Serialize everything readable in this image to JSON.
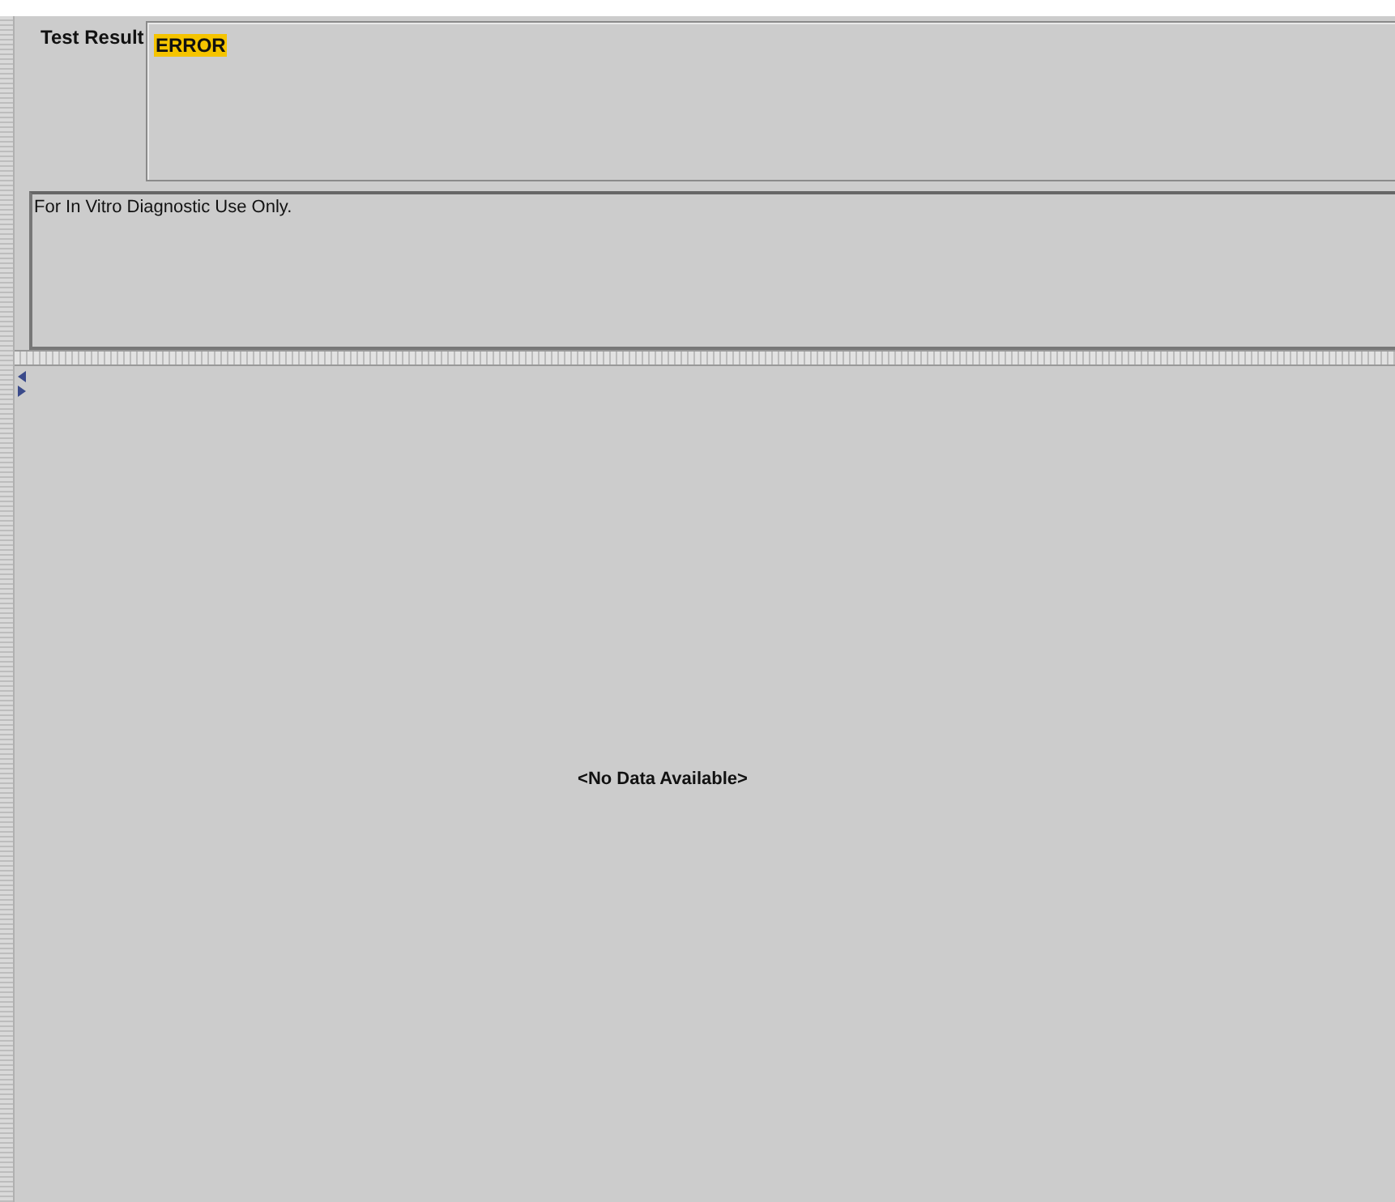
{
  "result_panel": {
    "label": "Test Result",
    "value": "ERROR",
    "highlighted": true
  },
  "note": {
    "text": "For In Vitro Diagnostic Use Only."
  },
  "data_panel": {
    "empty_message": "<No Data Available>"
  }
}
